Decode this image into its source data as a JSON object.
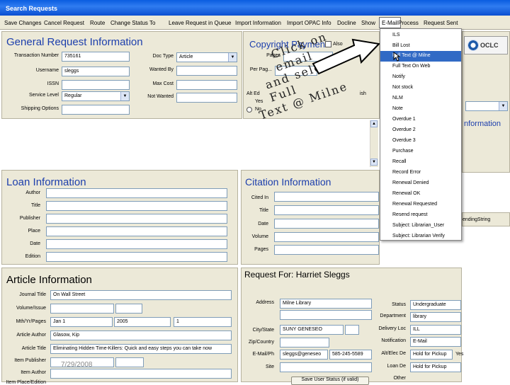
{
  "window": {
    "title": "Search Requests"
  },
  "menu": [
    "Save Changes",
    "Cancel Request",
    "Route",
    "Change Status To",
    "Leave Request in Queue",
    "Import Information",
    "Import OPAC Info",
    "Docline",
    "Show",
    "E-Mail",
    "Process",
    "Request Sent"
  ],
  "general": {
    "title": "General Request Information",
    "transaction_label": "Transaction Number",
    "transaction_value": "735161",
    "username_label": "Username",
    "username_value": "sleggs",
    "issn_label": "ISSN",
    "issn_value": "",
    "service_label": "Service Level",
    "service_value": "Regular",
    "shipping_label": "Shipping Options",
    "shipping_value": "",
    "doctype_label": "Doc Type",
    "doctype_value": "Article",
    "wanted_label": "Wanted By",
    "wanted_value": "",
    "maxcost_label": "Max Cost",
    "maxcost_value": "",
    "notwanted_label": "Not Wanted",
    "notwanted_value": ""
  },
  "copyright": {
    "title": "Copyright Payment",
    "pages_label": "Pages",
    "pagesa_label": "Per Pag...",
    "also_label": "Also",
    "alt_label": "Alt Ed",
    "yes_label": "Yes",
    "no_label": "No",
    "ish_label": "ish"
  },
  "annotation": [
    "Click on email",
    "and select Full",
    "Text @ Milne"
  ],
  "oclc": {
    "label": "OCLC"
  },
  "email_dropdown": [
    "ILS",
    "Bill Lost",
    "Full Text @ Milne",
    "Full Text On Web",
    "Notify",
    "Not stock",
    "NLM",
    "Note",
    "Overdue 1",
    "Overdue 2",
    "Overdue 3",
    "Purchase",
    "Recall",
    "Record Error",
    "Renewal Denied",
    "Renewal OK",
    "Renewal Requested",
    "Resend request",
    "Subject: Librarian_User",
    "Subject: Librarian Verify"
  ],
  "right_partial": {
    "info": "nformation",
    "tracking": "endingString"
  },
  "loan": {
    "title": "Loan Information",
    "fields": [
      "Author",
      "Title",
      "Publisher",
      "Place",
      "Date",
      "Edition"
    ]
  },
  "citation": {
    "title": "Citation Information",
    "fields": [
      "Cited In",
      "Title",
      "Date",
      "Volume",
      "Pages"
    ]
  },
  "article": {
    "title": "Article Information",
    "journal_label": "Journal Title",
    "journal_value": "On Wall Street",
    "volume_label": "Volume/Issue",
    "volume_value": "",
    "mth_label": "Mth/Yr/Pages",
    "month_value": "Jan 1",
    "year_value": "2005",
    "pages_value": "1",
    "author_label": "Article Author",
    "author_value": "Glasow, Kip",
    "atitle_label": "Article Title",
    "atitle_value": "Eliminating Hidden Time-Killers: Quick and easy steps you can take now",
    "ipub_label": "Item Publisher",
    "ipub_value": "",
    "iauthor_label": "Item Author",
    "iauthor_value": "",
    "iplace_label": "Item Place/Edition",
    "iplace_value": ""
  },
  "request_for": {
    "title": "Request For: Harriet Sleggs",
    "address_label": "Address",
    "address_value": "Milne Library",
    "city_label": "City/State",
    "city_value": "SUNY GENESEO",
    "zip_label": "Zip/Country",
    "zip_value": "",
    "email_label": "E-Mail/Ph",
    "email_value": "sleggs@geneseo",
    "phone_value": "585-245-5589",
    "site_label": "Site",
    "site_value": "",
    "status_label": "Status",
    "status_value": "Undergraduate",
    "dept_label": "Department",
    "dept_value": "library",
    "delivery_label": "Delivery Loc",
    "delivery_value": "ILL",
    "notif_label": "Notification",
    "notif_value": "E-Mail",
    "altdel_label": "Alt/Elec De",
    "altdel_value": "Hold for Pickup",
    "altdel_yes": "Yes",
    "loande_label": "Loan De",
    "loande_value": "Hold for Pickup",
    "other_label": "Other",
    "save_label": "Save User Status (if valid)"
  },
  "date_stamp": "7/29/2008"
}
